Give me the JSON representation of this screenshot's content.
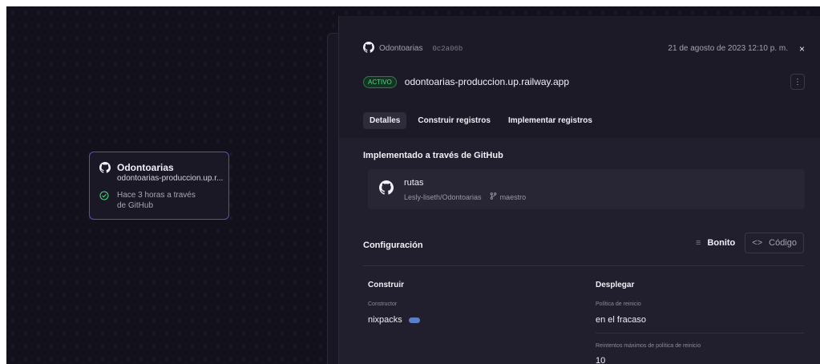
{
  "canvas_card": {
    "title": "Odontoarias",
    "url": "odontoarias-produccion.up.r...",
    "status": "Hace 3 horas a través de GitHub"
  },
  "panel": {
    "service_name": "Odontoarias",
    "commit_hash": "0c2a06b",
    "timestamp": "21 de agosto de 2023 12:10 p. m.",
    "close": "×",
    "badge": "ACTIVO",
    "domain": "odontoarias-produccion.up.railway.app",
    "menu": "⋮",
    "tabs": [
      "Detalles",
      "Construir registros",
      "Implementar registros"
    ],
    "deployed_title": "Implementado a través de GitHub",
    "commit": {
      "message": "rutas",
      "repo": "Lesly-liseth/Odontoarias",
      "branch": "maestro"
    },
    "config": {
      "title": "Configuración",
      "pretty": "Bonito",
      "code": "Código",
      "build": {
        "heading": "Construir",
        "builder_label": "Constructor",
        "builder_value": "nixpacks"
      },
      "deploy": {
        "heading": "Desplegar",
        "restart_label": "Política de reinicio",
        "restart_value": "en el fracaso",
        "retries_label": "Reintentos máximos de política de reinicio",
        "retries_value": "10"
      }
    }
  }
}
